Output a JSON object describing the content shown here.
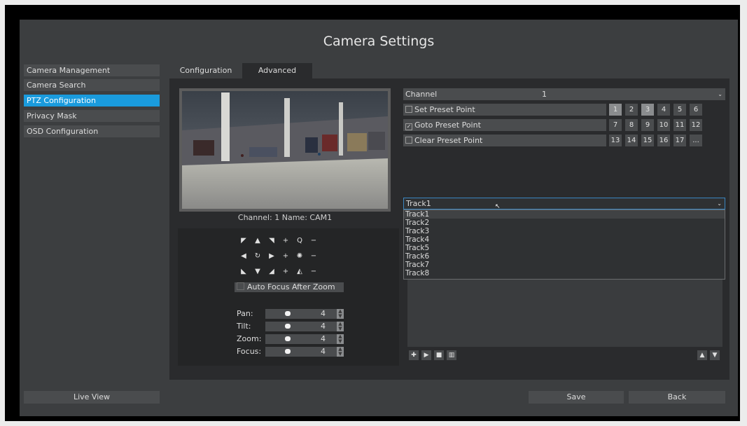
{
  "window": {
    "title": "Camera Settings"
  },
  "sidebar": {
    "items": [
      {
        "label": "Camera Management"
      },
      {
        "label": "Camera Search"
      },
      {
        "label": "PTZ Configuration"
      },
      {
        "label": "Privacy Mask"
      },
      {
        "label": "OSD Configuration"
      }
    ],
    "active_index": 2,
    "live_view_label": "Live View"
  },
  "tabs": [
    {
      "label": "Configuration"
    },
    {
      "label": "Advanced"
    }
  ],
  "active_tab": 1,
  "preview": {
    "caption": "Channel: 1 Name: CAM1"
  },
  "ptz": {
    "icons": [
      "arrow-up-left-icon",
      "arrow-up-icon",
      "arrow-up-right-icon",
      "plus-icon",
      "zoom-icon",
      "minus-icon",
      "arrow-left-icon",
      "rotate-icon",
      "arrow-right-icon",
      "plus-icon",
      "focus-icon",
      "minus-icon",
      "arrow-down-left-icon",
      "arrow-down-icon",
      "arrow-down-right-icon",
      "plus-icon",
      "iris-icon",
      "minus-icon"
    ],
    "auto_focus_label": "Auto Focus After Zoom",
    "auto_focus_checked": false,
    "sliders": [
      {
        "label": "Pan:",
        "value": "4"
      },
      {
        "label": "Tilt:",
        "value": "4"
      },
      {
        "label": "Zoom:",
        "value": "4"
      },
      {
        "label": "Focus:",
        "value": "4"
      }
    ]
  },
  "preset": {
    "channel_label": "Channel",
    "channel_value": "1",
    "rows": [
      {
        "label": "Set Preset Point",
        "checked": false
      },
      {
        "label": "Goto Preset Point",
        "checked": true
      },
      {
        "label": "Clear Preset Point",
        "checked": false
      }
    ],
    "numbers": [
      "1",
      "2",
      "3",
      "4",
      "5",
      "6",
      "7",
      "8",
      "9",
      "10",
      "11",
      "12",
      "13",
      "14",
      "15",
      "16",
      "17",
      "..."
    ],
    "highlighted": [
      "1",
      "3"
    ]
  },
  "track": {
    "selected": "Track1",
    "options": [
      "Track1",
      "Track2",
      "Track3",
      "Track4",
      "Track5",
      "Track6",
      "Track7",
      "Track8"
    ],
    "toolbar_icons": [
      "add-icon",
      "play-icon",
      "stop-icon",
      "delete-icon"
    ],
    "nav_icons": [
      "move-up-icon",
      "move-down-icon"
    ]
  },
  "buttons": {
    "save": "Save",
    "back": "Back"
  },
  "colors": {
    "accent": "#1a9bdd",
    "background": "#3c3e40",
    "panel": "#2a2b2d"
  }
}
